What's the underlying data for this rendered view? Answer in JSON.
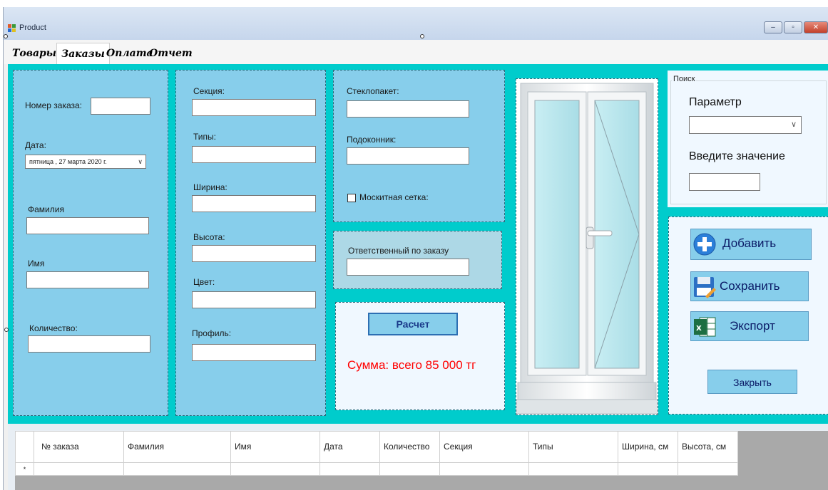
{
  "window": {
    "title": "Product"
  },
  "tabs": [
    {
      "label": "Товары"
    },
    {
      "label": "Заказы"
    },
    {
      "label": "Оплата"
    },
    {
      "label": "Отчет"
    }
  ],
  "order_panel": {
    "order_number_label": "Номер заказа:",
    "date_label": "Дата:",
    "date_value": "пятница   , 27   марта   2020 г.",
    "surname_label": "Фамилия",
    "name_label": "Имя",
    "quantity_label": "Количество:"
  },
  "dimensions_panel": {
    "section_label": "Секция:",
    "types_label": "Типы:",
    "width_label": "Ширина:",
    "height_label": "Высота:",
    "color_label": "Цвет:",
    "profile_label": "Профиль:"
  },
  "glass_panel": {
    "glass_unit_label": "Стеклопакет:",
    "windowsill_label": "Подоконник:",
    "mosquito_net_label": "Москитная сетка:",
    "mosquito_net_checked": false
  },
  "responsible_panel": {
    "label": "Ответственный по заказу"
  },
  "calc_panel": {
    "calc_button": "Расчет",
    "sum_text": "Сумма: всего 85 000 тг"
  },
  "search": {
    "group_title": "Поиск",
    "parameter_label": "Параметр",
    "value_label": "Введите значение"
  },
  "actions": {
    "add_label": "Добавить",
    "save_label": "Сохранить",
    "export_label": "Экспорт",
    "close_label": "Закрыть"
  },
  "grid": {
    "columns": [
      "№ заказа",
      "Фамилия",
      "Имя",
      "Дата",
      "Количество",
      "Секция",
      "Типы",
      "Ширина, см",
      "Высота, см"
    ],
    "new_row_marker": "*"
  },
  "colors": {
    "main_bg": "#00cccc",
    "panel_bg": "#87ceeb",
    "light_panel_bg": "#f0f8ff",
    "sum_text": "#ff0000"
  }
}
